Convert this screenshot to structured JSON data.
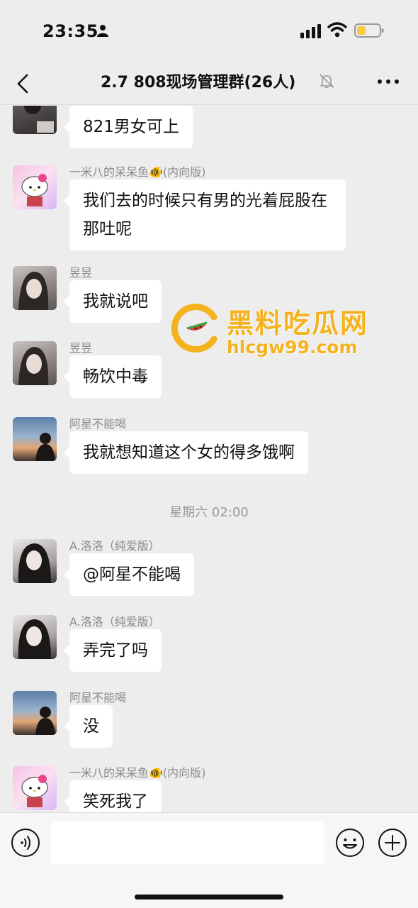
{
  "status_bar": {
    "time": "23:35"
  },
  "header": {
    "title": "2.7 808现场管理群(26人)"
  },
  "messages": [
    {
      "text": "821男女可上"
    },
    {
      "sender": "一米八的呆呆鱼🐠(内向版)",
      "text": "我们去的时候只有男的光着屁股在那吐呢"
    },
    {
      "sender": "昱昱",
      "text": "我就说吧"
    },
    {
      "sender": "昱昱",
      "text": "畅饮中毒"
    },
    {
      "sender": "阿星不能喝",
      "text": "我就想知道这个女的得多饿啊"
    },
    {
      "sender": "A.洛洛（纯爱版）",
      "text": "@阿星不能喝"
    },
    {
      "sender": "A.洛洛（纯爱版）",
      "text": "弄完了吗"
    },
    {
      "sender": "阿星不能喝",
      "text": "没"
    },
    {
      "sender": "一米八的呆呆鱼🐠(内向版)",
      "text": "笑死我了"
    }
  ],
  "timestamp": "星期六 02:00",
  "watermark": {
    "title": "黑料吃瓜网",
    "url": "hlcgw99.com"
  },
  "icons": {
    "person": "person-icon",
    "signal": "signal-icon",
    "wifi": "wifi-icon",
    "battery": "battery-icon",
    "back": "chevron-left-icon",
    "mute": "bell-off-icon",
    "more": "more-icon",
    "voice": "voice-icon",
    "emoji": "emoji-icon",
    "plus": "plus-icon"
  },
  "colors": {
    "background": "#ededed",
    "bubble": "#ffffff",
    "battery_fill": "#f7c844",
    "watermark": "#f5b21f"
  }
}
